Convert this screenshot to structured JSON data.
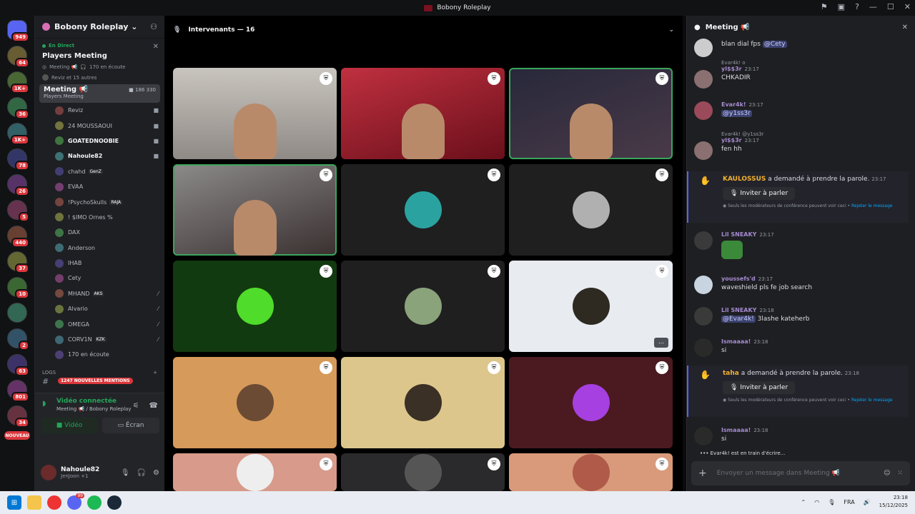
{
  "window": {
    "title": "Bobony Roleplay"
  },
  "servers": [
    {
      "label": "",
      "badge": "949",
      "home": true
    },
    {
      "label": "",
      "badge": "64"
    },
    {
      "label": "",
      "badge": "1K+"
    },
    {
      "label": "",
      "badge": "36"
    },
    {
      "label": "",
      "badge": "1K+"
    },
    {
      "label": "",
      "badge": "78"
    },
    {
      "label": "",
      "badge": "26"
    },
    {
      "label": "",
      "badge": "5"
    },
    {
      "label": "",
      "badge": "440"
    },
    {
      "label": "",
      "badge": "37"
    },
    {
      "label": "",
      "badge": "10"
    },
    {
      "label": "",
      "badge": ""
    },
    {
      "label": "",
      "badge": "2"
    },
    {
      "label": "",
      "badge": "63"
    },
    {
      "label": "",
      "badge": "801"
    },
    {
      "label": "",
      "badge": "34"
    }
  ],
  "server_new": "NOUVEAU",
  "sidebar": {
    "server_name": "Bobony Roleplay",
    "live_label": "En Direct",
    "stage_title": "Players Meeting",
    "stage_meta": "Meeting 📢",
    "listeners": "170 en écoute",
    "speakers_meta": "Reviz et 15 autres",
    "channel": {
      "name": "Meeting 📢",
      "sub": "Players Meeting",
      "count_a": "186",
      "count_b": "330"
    },
    "participants": [
      {
        "name": "Reviz",
        "tag": "",
        "bold": false
      },
      {
        "name": "24 MOUSSAOUI",
        "tag": "",
        "bold": false
      },
      {
        "name": "GOATEDNOOBIE",
        "tag": "",
        "bold": true
      },
      {
        "name": "Nahoule82",
        "tag": "",
        "bold": true
      },
      {
        "name": "chahd",
        "tag": "GenZ",
        "bold": false
      },
      {
        "name": "EVAA",
        "tag": "",
        "bold": false
      },
      {
        "name": "!PsychoSkulls",
        "tag": "RAJA",
        "bold": false
      },
      {
        "name": "! $IMO Ornes %",
        "tag": "",
        "bold": false
      },
      {
        "name": "DAX",
        "tag": "",
        "bold": false
      },
      {
        "name": "Anderson",
        "tag": "",
        "bold": false
      },
      {
        "name": "IHAB",
        "tag": "",
        "bold": false
      },
      {
        "name": "Cety",
        "tag": "",
        "bold": false
      },
      {
        "name": "MHAND",
        "tag": "AKS",
        "bold": false
      },
      {
        "name": "Alvario",
        "tag": "",
        "bold": false
      },
      {
        "name": "OMEGA",
        "tag": "",
        "bold": false
      },
      {
        "name": "CORV1N",
        "tag": "KZK",
        "bold": false
      },
      {
        "name": "170 en écoute",
        "tag": "",
        "bold": false
      }
    ],
    "logs": "LOGS",
    "mentions": "1247 NOUVELLES MENTIONS",
    "voice": {
      "status": "Vidéo connectée",
      "sub": "Meeting 📢 / Bobony Roleplay",
      "video": "Vidéo",
      "screen": "Écran"
    },
    "user": {
      "name": "Nahoule82",
      "status": "JenJoon +1"
    }
  },
  "stage": {
    "header": "Intervenants — 16"
  },
  "tiles": [
    {
      "type": "cam1"
    },
    {
      "type": "cam2"
    },
    {
      "type": "cam3",
      "speaking": true
    },
    {
      "type": "cam4",
      "speaking": true
    },
    {
      "type": "avatar",
      "bg": "#1f1f20",
      "av": "#2aa3a0"
    },
    {
      "type": "avatar",
      "bg": "#1f1f20",
      "av": "#b0b0b0"
    },
    {
      "type": "avatar",
      "bg": "#123a10",
      "av": "#4fdc2a"
    },
    {
      "type": "avatar",
      "bg": "#1f1f20",
      "av": "#8aa37a"
    },
    {
      "type": "avatar",
      "bg": "#e8ecf0",
      "av": "#2e2a22",
      "more": true
    },
    {
      "type": "avatar",
      "bg": "#d69a5a",
      "av": "#6b4b34"
    },
    {
      "type": "avatar",
      "bg": "#dcc68c",
      "av": "#3a3026"
    },
    {
      "type": "avatar",
      "bg": "#4a1a20",
      "av": "#a640e0"
    },
    {
      "type": "avatar",
      "bg": "#d89a8a",
      "av": "#eee"
    },
    {
      "type": "avatar",
      "bg": "#2a2a2c",
      "av": "#555"
    },
    {
      "type": "avatar",
      "bg": "#d89a7a",
      "av": "#b05a4a"
    }
  ],
  "chat": {
    "title": "Meeting 📢",
    "messages": [
      {
        "text": "blan dial fps",
        "mention": "@Cety"
      },
      {
        "reply": "Evar4k! o",
        "user": "yl$$3r",
        "time": "23:17",
        "text": "CHKADIR"
      },
      {
        "user": "Evar4k!",
        "time": "23:17",
        "text": "",
        "mention": "@y1ss3r"
      },
      {
        "reply": "Evar4k! @y1ss3r",
        "user": "yl$$3r",
        "time": "23:17",
        "text": "fen hh"
      },
      {
        "user": "Lil SNEAKY",
        "time": "23:17",
        "text": ""
      },
      {
        "user": "youssefs'd",
        "time": "23:17",
        "text": "waveshield pls fe job search"
      },
      {
        "user": "Lil SNEAKY",
        "time": "23:18",
        "text": "3lashe kateherb",
        "mention": "@Evar4k!"
      },
      {
        "user": "Ismaaaa!",
        "time": "23:18",
        "text": "si"
      },
      {
        "user": "Ismaaaa!",
        "time": "23:18",
        "text": "si"
      }
    ],
    "requests": [
      {
        "user": "KAULOSSUS",
        "action": "a demandé à prendre la parole.",
        "time": "23:17"
      },
      {
        "user": "taha",
        "action": "a demandé à prendre la parole.",
        "time": "23:18"
      }
    ],
    "invite_label": "Inviter à parler",
    "note": "Seuls les modérateurs de conférence peuvent voir ceci • ",
    "reject": "Rejeter le message",
    "typing": "Evar4k! est en train d'écrire...",
    "placeholder": "Envoyer un message dans Meeting 📢"
  },
  "taskbar": {
    "lang": "FRA",
    "time": "23:18",
    "date": "15/12/2025"
  }
}
